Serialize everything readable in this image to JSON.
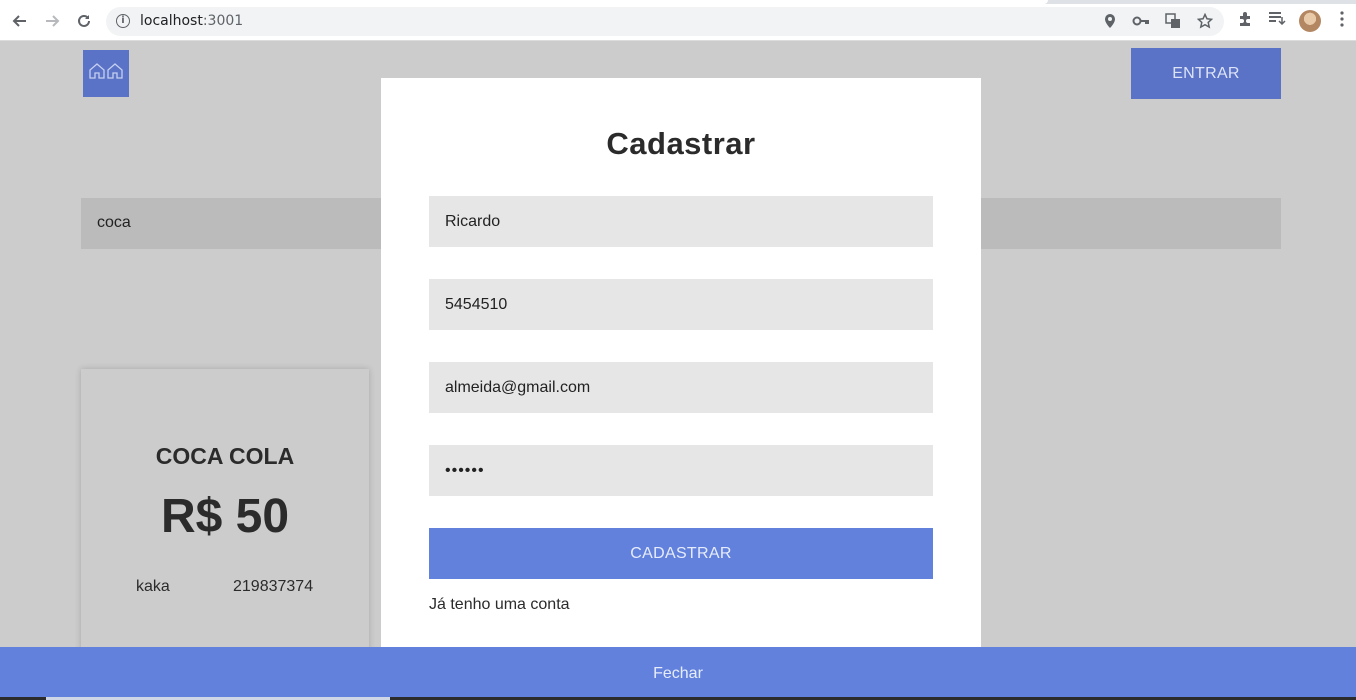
{
  "browser": {
    "url_host": "localhost",
    "url_port": ":3001"
  },
  "header": {
    "enter_label": "ENTRAR"
  },
  "search": {
    "value": "coca"
  },
  "product": {
    "name": "COCA COLA",
    "price": "R$ 50",
    "meta_left": "kaka",
    "meta_right": "219837374"
  },
  "modal": {
    "title": "Cadastrar",
    "fields": {
      "name": "Ricardo",
      "phone": "5454510",
      "email": "almeida@gmail.com",
      "password": "••••••"
    },
    "submit_label": "CADASTRAR",
    "account_link": "Já tenho uma conta"
  },
  "footer": {
    "close_label": "Fechar"
  },
  "colors": {
    "primary": "#6181dd",
    "header_button": "#5a73c7",
    "backdrop": "#cccccc"
  }
}
